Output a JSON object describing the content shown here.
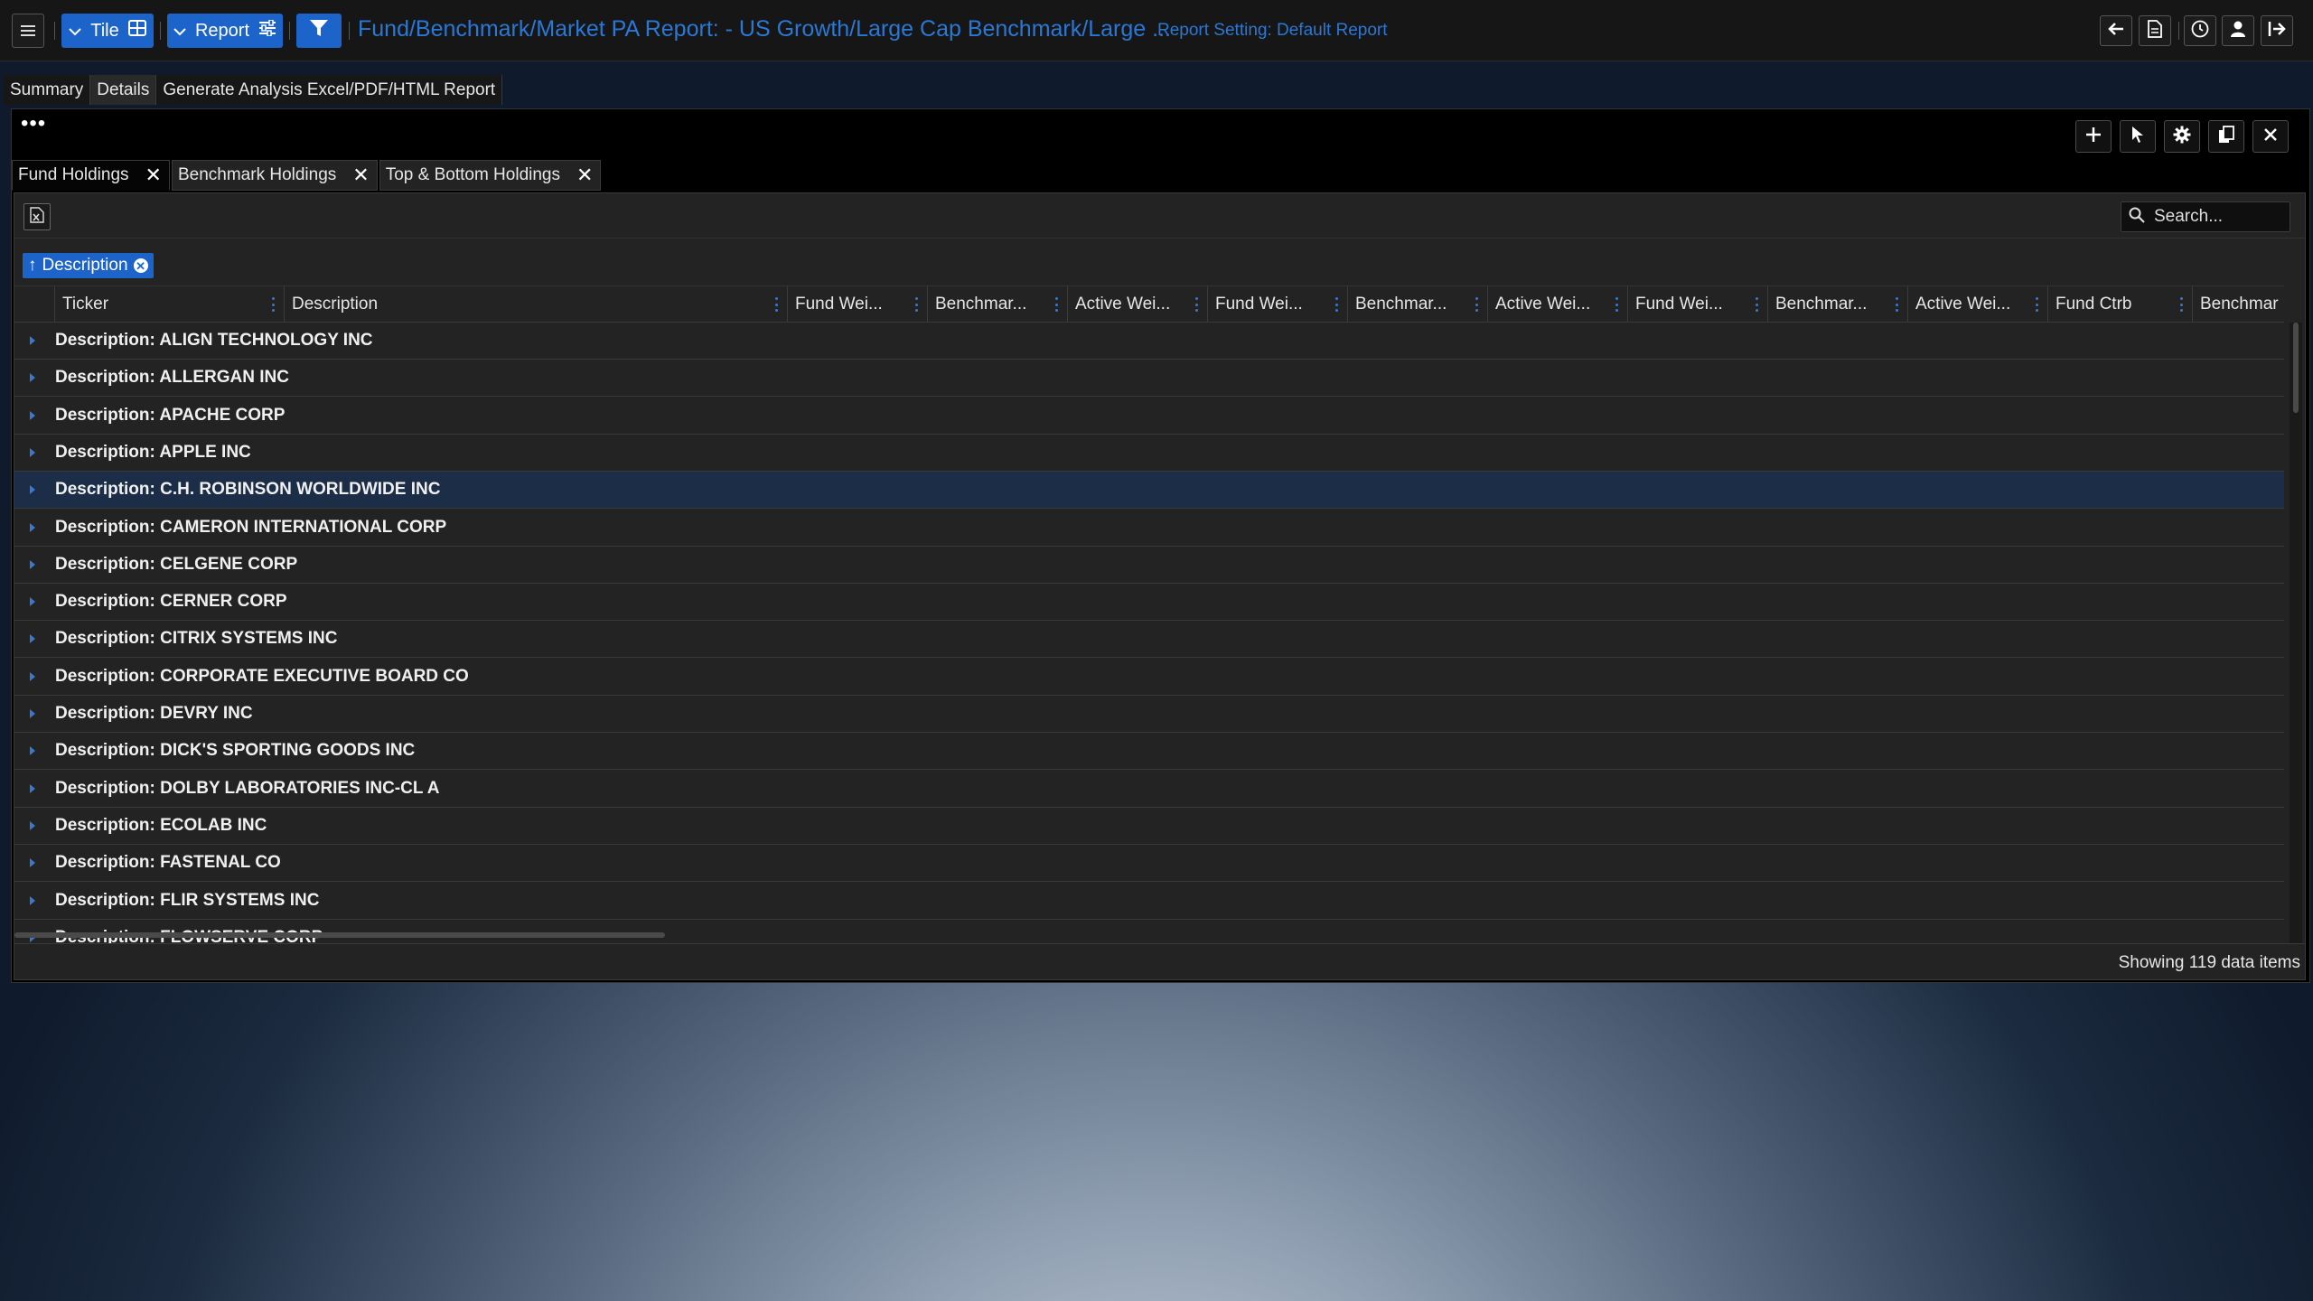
{
  "toolbar": {
    "tile_label": "Tile",
    "report_label": "Report",
    "title": "Fund/Benchmark/Market PA Report: - US Growth/Large Cap Benchmark/Large ...",
    "report_setting": "Report Setting: Default Report"
  },
  "page_tabs": [
    "Summary",
    "Details",
    "Generate Analysis Excel/PDF/HTML Report"
  ],
  "panel": {
    "dots": "•••"
  },
  "grid_tabs": [
    "Fund Holdings",
    "Benchmark Holdings",
    "Top & Bottom Holdings"
  ],
  "search": {
    "placeholder": "Search..."
  },
  "group_chip": {
    "arrow": "↑",
    "label": "Description"
  },
  "columns": [
    "Ticker",
    "Description",
    "Fund Wei...",
    "Benchmar...",
    "Active Wei...",
    "Fund Wei...",
    "Benchmar...",
    "Active Wei...",
    "Fund Wei...",
    "Benchmar...",
    "Active Wei...",
    "Fund Ctrb",
    "Benchmar"
  ],
  "rows": [
    "Description: ALIGN TECHNOLOGY INC",
    "Description: ALLERGAN INC",
    "Description: APACHE CORP",
    "Description: APPLE INC",
    "Description: C.H. ROBINSON WORLDWIDE INC",
    "Description: CAMERON INTERNATIONAL CORP",
    "Description: CELGENE CORP",
    "Description: CERNER CORP",
    "Description: CITRIX SYSTEMS INC",
    "Description: CORPORATE EXECUTIVE BOARD CO",
    "Description: DEVRY INC",
    "Description: DICK'S SPORTING GOODS INC",
    "Description: DOLBY LABORATORIES INC-CL A",
    "Description: ECOLAB INC",
    "Description: FASTENAL CO",
    "Description: FLIR SYSTEMS INC",
    "Description: FLOWSERVE CORP"
  ],
  "selected_row": 4,
  "footer": {
    "status": "Showing 119 data items"
  },
  "colors": {
    "accent": "#1c64c9",
    "title_blue": "#2a78d6",
    "selected_row": "#1c2d47"
  }
}
